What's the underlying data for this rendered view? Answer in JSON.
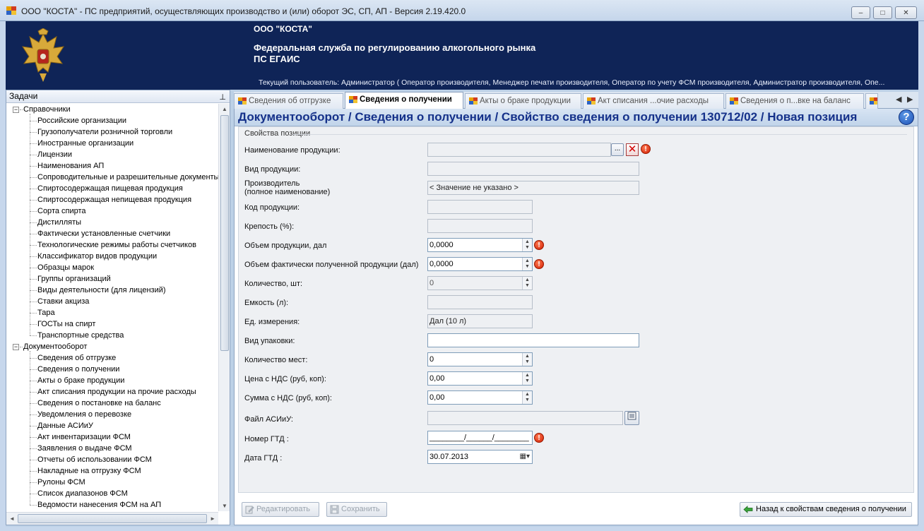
{
  "window": {
    "title": "ООО \"КОСТА\" - ПС предприятий, осуществляющих производство и (или) оборот ЭС, СП, АП - Версия 2.19.420.0",
    "minimize": "–",
    "maximize": "□",
    "close": "✕"
  },
  "header": {
    "org_name": "ООО \"КОСТА\"",
    "agency": "Федеральная служба по регулированию алкогольного рынка",
    "system": "ПС ЕГАИС",
    "current_user": "Текущий пользователь: Администратор ( Оператор производителя, Менеджер печати производителя, Оператор по учету ФСМ производителя, Администратор производителя, Опе..."
  },
  "tasks_panel": {
    "title": "Задачи",
    "groups": [
      {
        "label": "Справочники",
        "items": [
          "Российские организации",
          "Грузополучатели розничной торговли",
          "Иностранные организации",
          "Лицензии",
          "Наименования АП",
          "Сопроводительные и разрешительные документы",
          "Спиртосодержащая пищевая продукция",
          "Спиртосодержащая непищевая продукция",
          "Сорта спирта",
          "Дистилляты",
          "Фактически установленные счетчики",
          "Технологические режимы работы счетчиков",
          "Классификатор видов продукции",
          "Образцы марок",
          "Группы организаций",
          "Виды деятельности (для лицензий)",
          "Ставки акциза",
          "Тара",
          "ГОСТы на спирт",
          "Транспортные средства"
        ]
      },
      {
        "label": "Документооборот",
        "items": [
          "Сведения об отгрузке",
          "Сведения о получении",
          "Акты о браке продукции",
          "Акт списания продукции на прочие расходы",
          "Сведения о постановке на баланс",
          "Уведомления о перевозке",
          "Данные АСИиУ",
          "Акт инвентаризации ФСМ",
          "Заявления о выдаче ФСМ",
          "Отчеты об использовании ФСМ",
          "Накладные на отгрузку ФСМ",
          "Рулоны ФСМ",
          "Список диапазонов ФСМ",
          "Ведомости нанесения ФСМ на АП"
        ]
      }
    ]
  },
  "tabs": [
    {
      "label": "Сведения об отгрузке",
      "active": false
    },
    {
      "label": "Сведения о получении",
      "active": true
    },
    {
      "label": "Акты о браке продукции",
      "active": false
    },
    {
      "label": "Акт списания ...очие расходы",
      "active": false
    },
    {
      "label": "Сведения о п...вке на баланс",
      "active": false
    }
  ],
  "breadcrumb": "Документооборот  / Сведения о получении / Свойство сведения о получении 130712/02 / Новая позиция",
  "form": {
    "group_title": "Свойства позиции",
    "fields": {
      "product_name": {
        "label": "Наименование продукции:",
        "value": ""
      },
      "product_kind": {
        "label": "Вид продукции:",
        "value": ""
      },
      "producer": {
        "label_line1": "Производитель",
        "label_line2": "(полное наименование)",
        "value": "< Значение не указано >"
      },
      "product_code": {
        "label": "Код продукции:",
        "value": ""
      },
      "strength": {
        "label": "Крепость (%):",
        "value": ""
      },
      "volume": {
        "label": "Объем продукции, дал",
        "value": "0,0000"
      },
      "volume_received": {
        "label": "Объем фактически полученной продукции (дал)",
        "value": "0,0000"
      },
      "quantity": {
        "label": "Количество, шт:",
        "value": "0"
      },
      "capacity": {
        "label": "Емкость (л):",
        "value": ""
      },
      "unit": {
        "label": "Ед. измерения:",
        "value": "Дал (10 л)"
      },
      "package_type": {
        "label": "Вид упаковки:",
        "value": ""
      },
      "places_count": {
        "label": "Количество мест:",
        "value": "0"
      },
      "price_vat": {
        "label": "Цена с НДС  (руб, коп):",
        "value": "0,00"
      },
      "sum_vat": {
        "label": "Сумма с НДС  (руб, коп):",
        "value": "0,00"
      },
      "asiiu_file": {
        "label": "Файл АСИиУ:",
        "value": ""
      },
      "gtd_number": {
        "label": "Номер ГТД :",
        "value": "________/______/________"
      },
      "gtd_date": {
        "label": "Дата ГТД :",
        "value": "30.07.2013"
      }
    },
    "browse_btn": "...",
    "error_mark": "!"
  },
  "buttons": {
    "edit": "Редактировать",
    "save": "Сохранить",
    "back": "Назад к свойствам сведения о получении"
  },
  "icons": {
    "help": "?",
    "pin": "⊥"
  },
  "colors": {
    "banner": "#0f2457",
    "breadcrumb_text": "#15318a",
    "error": "#d01d00"
  }
}
